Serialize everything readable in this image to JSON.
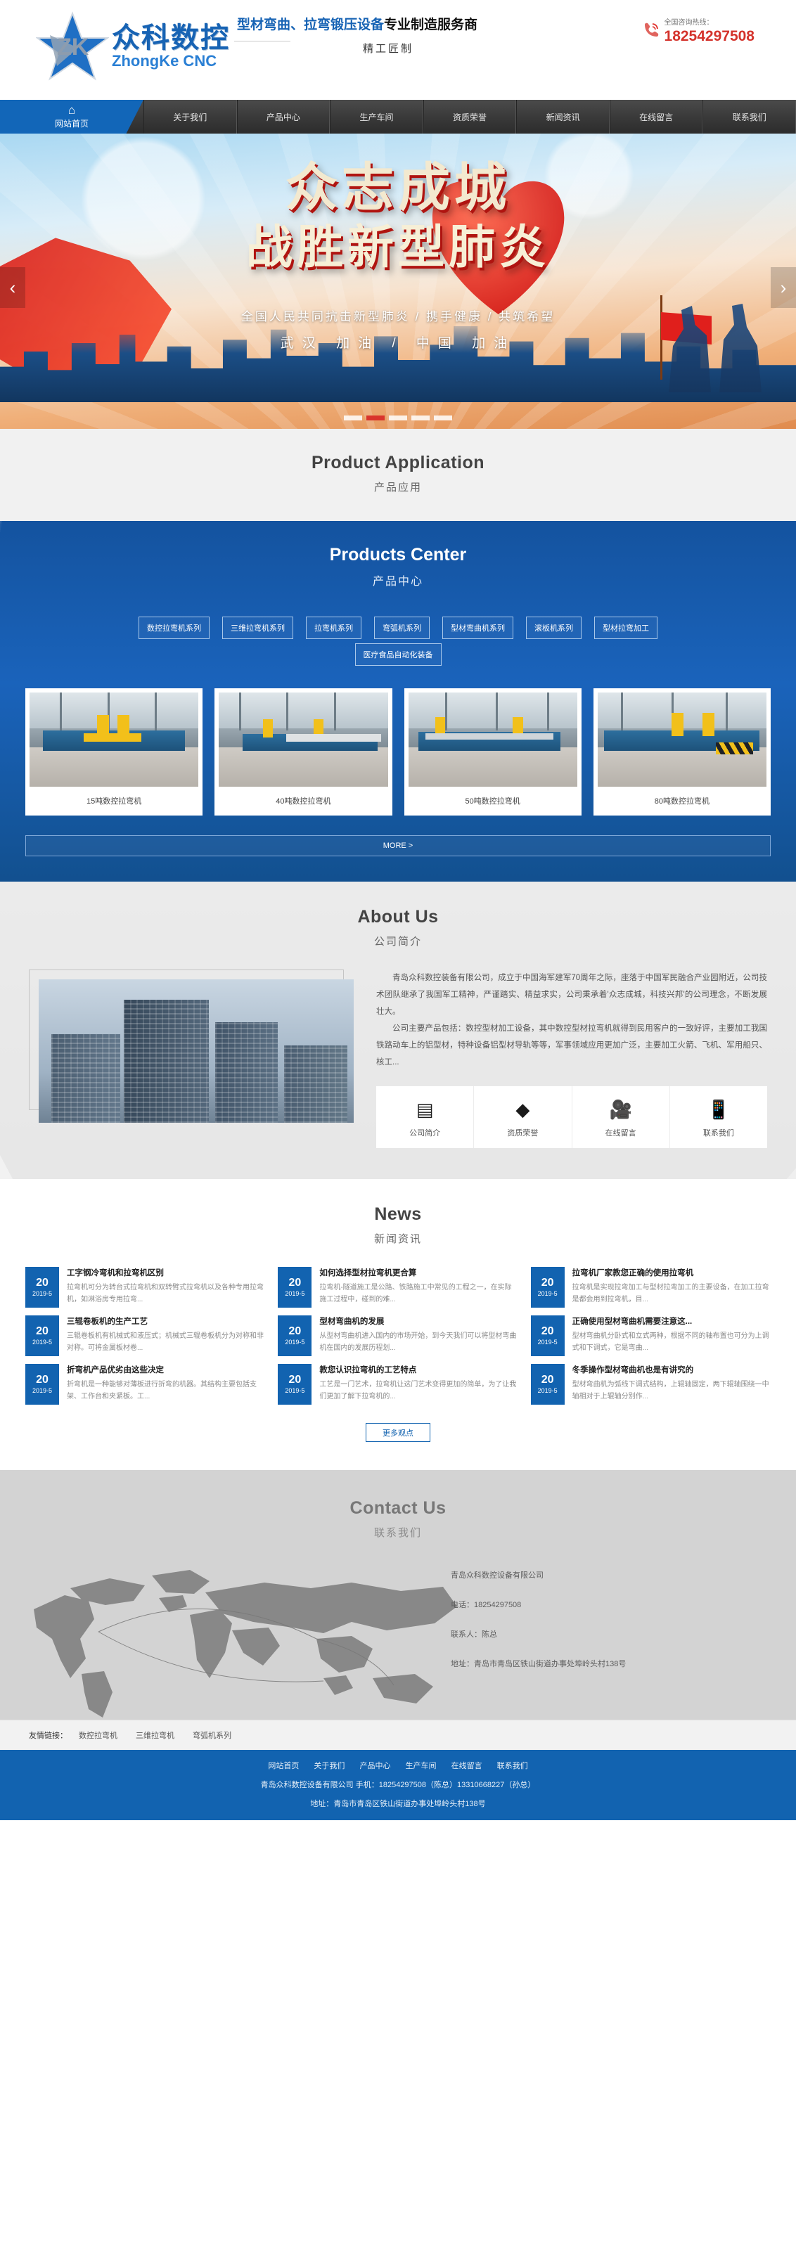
{
  "header": {
    "logo_cn": "众科数控",
    "logo_en": "ZhongKe CNC",
    "slogan_blue": "型材弯曲、拉弯锻压设备",
    "slogan_black": "专业制造服务商",
    "slogan_sub": "精工匠制",
    "tel_label": "全国咨询热线：",
    "tel_number": "18254297508",
    "phone_icon": "phone-icon"
  },
  "nav": {
    "items": [
      {
        "label": "网站首页",
        "icon": "home-icon",
        "active": true
      },
      {
        "label": "关于我们",
        "active": false
      },
      {
        "label": "产品中心",
        "active": false
      },
      {
        "label": "生产车间",
        "active": false
      },
      {
        "label": "资质荣誉",
        "active": false
      },
      {
        "label": "新闻资讯",
        "active": false
      },
      {
        "label": "在线留言",
        "active": false
      },
      {
        "label": "联系我们",
        "active": false
      }
    ]
  },
  "banner": {
    "title_line1": "众志成城",
    "title_line2": "战胜新型肺炎",
    "sub_line1": "全国人民共同抗击新型肺炎 / 携手健康 / 共筑希望",
    "sub_line2": "武汉 加油 / 中国 加油",
    "prev": "‹",
    "next": "›",
    "dots": 5,
    "active_dot": 1
  },
  "product_application": {
    "en": "Product Application",
    "cn": "产品应用"
  },
  "products": {
    "en": "Products Center",
    "cn": "产品中心",
    "tabs_row1": [
      "数控拉弯机系列",
      "三维拉弯机系列",
      "拉弯机系列",
      "弯弧机系列",
      "型材弯曲机系列",
      "滚板机系列",
      "型材拉弯加工"
    ],
    "tabs_row2": [
      "医疗食品自动化装备"
    ],
    "cards": [
      {
        "caption": "15吨数控拉弯机"
      },
      {
        "caption": "40吨数控拉弯机"
      },
      {
        "caption": "50吨数控拉弯机"
      },
      {
        "caption": "80吨数控拉弯机"
      }
    ],
    "more": "MORE >"
  },
  "about": {
    "en": "About Us",
    "cn": "公司简介",
    "p1": "青岛众科数控装备有限公司，成立于中国海军建军70周年之际，座落于中国军民融合产业园附近，公司技术团队继承了我国军工精神，严谨踏实、精益求实，公司秉承着'众志成城，科技兴邦'的公司理念，不断发展壮大。",
    "p2": "公司主要产品包括：数控型材加工设备，其中数控型材拉弯机就得到民用客户的一致好评，主要加工我国铁路动车上的铝型材，特种设备铝型材导轨等等，军事领域应用更加广泛，主要加工火箭、飞机、军用船只、核工...",
    "icons": [
      {
        "glyph": "▤",
        "label": "公司简介",
        "name": "document-icon"
      },
      {
        "glyph": "◆",
        "label": "资质荣誉",
        "name": "diamond-icon"
      },
      {
        "glyph": "🎥",
        "label": "在线留言",
        "name": "video-camera-icon"
      },
      {
        "glyph": "📱",
        "label": "联系我们",
        "name": "mobile-phone-icon"
      }
    ]
  },
  "news": {
    "en": "News",
    "cn": "新闻资讯",
    "columns": [
      [
        {
          "day": "20",
          "ym": "2019-5",
          "title": "工字钢冷弯机和拉弯机区别",
          "desc": "拉弯机可分为转台式拉弯机和双转臂式拉弯机以及各种专用拉弯机，如淋浴房专用拉弯..."
        },
        {
          "day": "20",
          "ym": "2019-5",
          "title": "三辊卷板机的生产工艺",
          "desc": "三辊卷板机有机械式和液压式；机械式三辊卷板机分为对称和非对称。可将金属板材卷..."
        },
        {
          "day": "20",
          "ym": "2019-5",
          "title": "折弯机产品优劣由这些决定",
          "desc": "折弯机是一种能够对薄板进行折弯的机器。其结构主要包括支架、工作台和夹紧板。工..."
        }
      ],
      [
        {
          "day": "20",
          "ym": "2019-5",
          "title": "如何选择型材拉弯机更合算",
          "desc": "拉弯机-隧道施工是公路、铁路施工中常见的工程之一，在实际施工过程中，碰到的难..."
        },
        {
          "day": "20",
          "ym": "2019-5",
          "title": "型材弯曲机的发展",
          "desc": "从型材弯曲机进入国内的市场开始，到今天我们可以将型材弯曲机在国内的发展历程划..."
        },
        {
          "day": "20",
          "ym": "2019-5",
          "title": "教您认识拉弯机的工艺特点",
          "desc": "工艺是一门艺术，拉弯机让这门艺术变得更加的简单，为了让我们更加了解下拉弯机的..."
        }
      ],
      [
        {
          "day": "20",
          "ym": "2019-5",
          "title": "拉弯机厂家教您正确的使用拉弯机",
          "desc": "拉弯机是实现拉弯加工与型材拉弯加工的主要设备，在加工拉弯是都会用到拉弯机，目..."
        },
        {
          "day": "20",
          "ym": "2019-5",
          "title": "正确使用型材弯曲机需要注意这...",
          "desc": "型材弯曲机分卧式和立式两种，根据不同的轴布置也可分为上调式和下调式，它是弯曲..."
        },
        {
          "day": "20",
          "ym": "2019-5",
          "title": "冬季操作型材弯曲机也是有讲究的",
          "desc": "型材弯曲机为弧线下调式结构，上辊轴固定，两下辊轴围绕一中轴相对于上辊轴分别作..."
        }
      ]
    ],
    "more": "更多观点"
  },
  "contact": {
    "en": "Contact Us",
    "cn": "联系我们",
    "company": "青岛众科数控设备有限公司",
    "phone": "电话：18254297508",
    "person": "联系人：陈总",
    "address": "地址：青岛市青岛区铁山街道办事处埠岭头村138号"
  },
  "friend_links": {
    "label": "友情链接：",
    "items": [
      "数控拉弯机",
      "三维拉弯机",
      "弯弧机系列"
    ]
  },
  "footer": {
    "nav": [
      "网站首页",
      "关于我们",
      "产品中心",
      "生产车间",
      "在线留言",
      "联系我们"
    ],
    "line1": "青岛众科数控设备有限公司  手机：18254297508（陈总）13310668227（孙总）",
    "line2": "地址：青岛市青岛区铁山街道办事处埠岭头村138号"
  },
  "colors": {
    "brand_blue": "#1263b0",
    "nav_dark": "#3a3a3a",
    "accent_red": "#d4332c"
  }
}
